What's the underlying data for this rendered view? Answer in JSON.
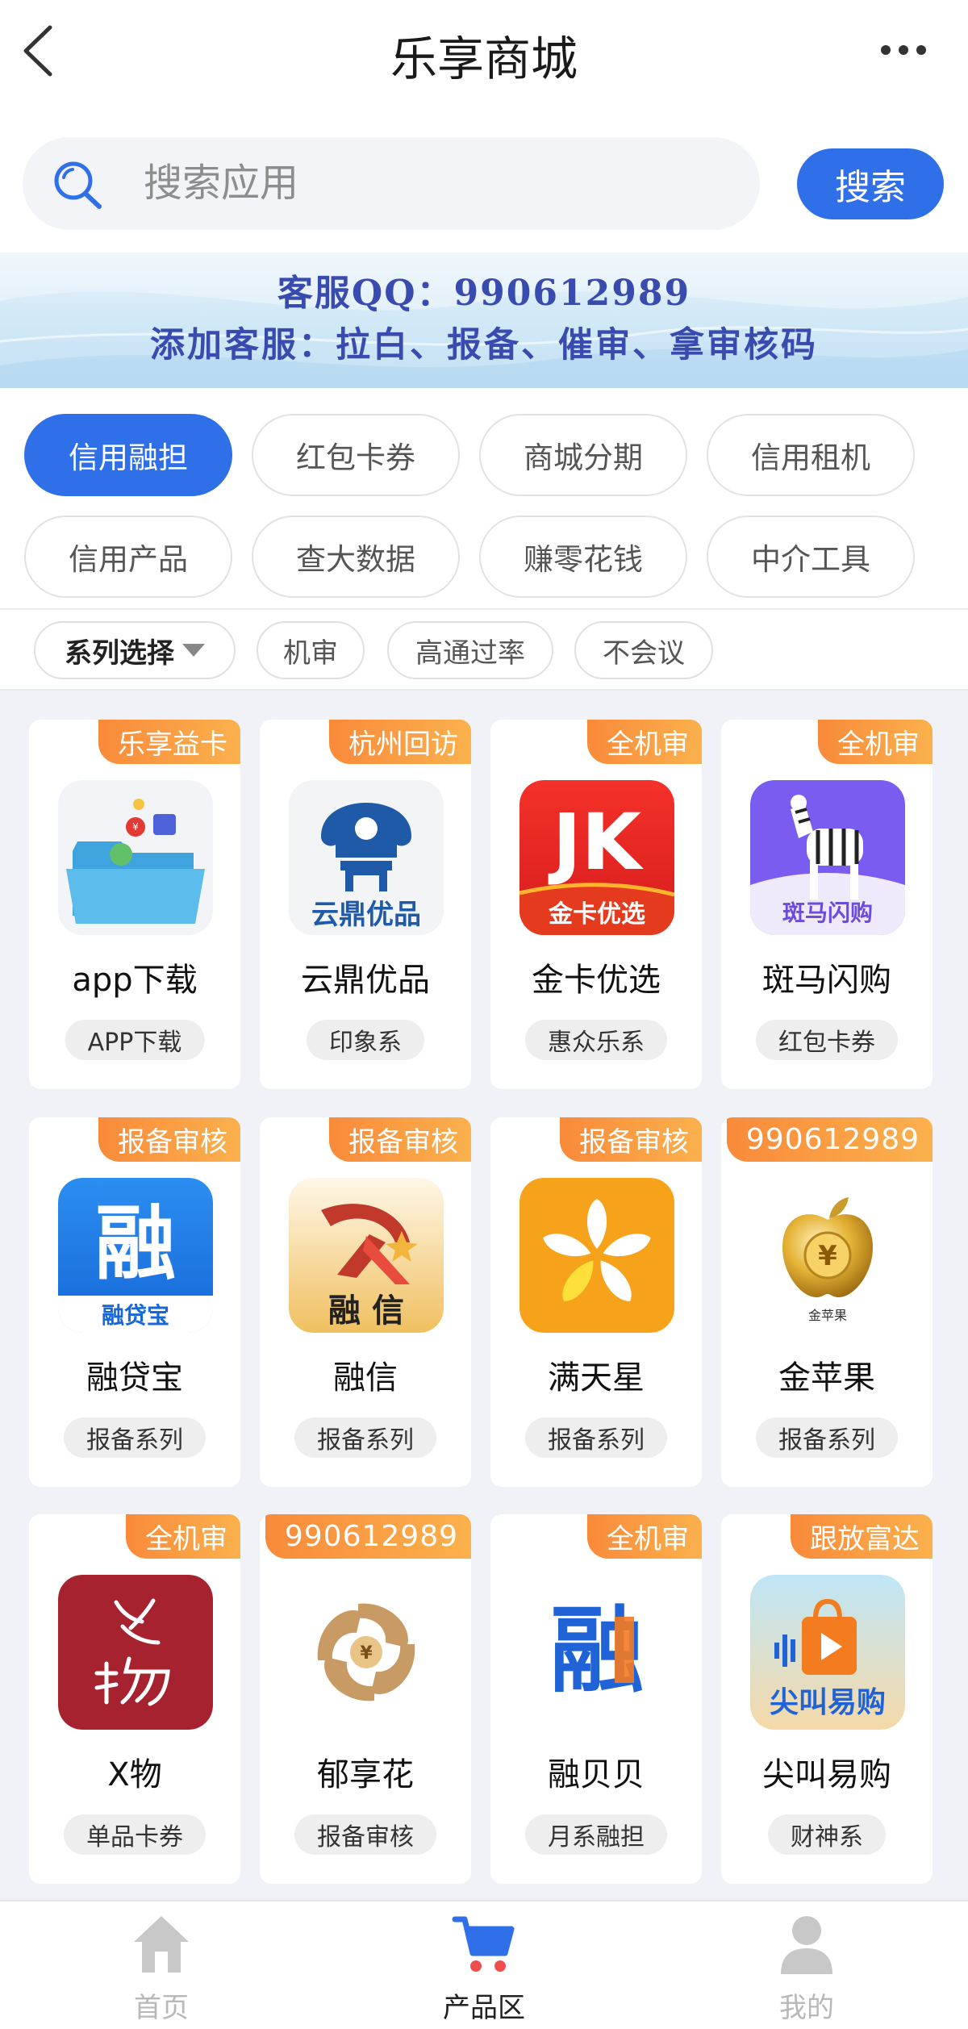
{
  "header": {
    "title": "乐享商城"
  },
  "search": {
    "placeholder": "搜索应用",
    "button_label": "搜索"
  },
  "banner": {
    "line1": "客服QQ：990612989",
    "line2": "添加客服：拉白、报备、催审、拿审核码"
  },
  "categories": [
    {
      "label": "信用融担",
      "active": true
    },
    {
      "label": "红包卡券",
      "active": false
    },
    {
      "label": "商城分期",
      "active": false
    },
    {
      "label": "信用租机",
      "active": false
    },
    {
      "label": "信用产品",
      "active": false
    },
    {
      "label": "查大数据",
      "active": false
    },
    {
      "label": "赚零花钱",
      "active": false
    },
    {
      "label": "中介工具",
      "active": false
    }
  ],
  "filters": {
    "select_label": "系列选择",
    "chips": [
      "机审",
      "高通过率",
      "不会议"
    ]
  },
  "products": [
    {
      "tag": "乐享益卡",
      "name": "app下载",
      "series": "APP下载",
      "icon": "folder-coins-icon"
    },
    {
      "tag": "杭州回访",
      "name": "云鼎优品",
      "series": "印象系",
      "icon": "yunding-logo-icon",
      "icon_text": "云鼎优品"
    },
    {
      "tag": "全机审",
      "name": "金卡优选",
      "series": "惠众乐系",
      "icon": "jk-logo-icon",
      "icon_text": "JK",
      "icon_subtext": "金卡优选"
    },
    {
      "tag": "全机审",
      "name": "斑马闪购",
      "series": "红包卡券",
      "icon": "zebra-logo-icon",
      "icon_text": "斑马闪购"
    },
    {
      "tag": "报备审核",
      "name": "融贷宝",
      "series": "报备系列",
      "icon": "rongdaibao-logo-icon",
      "icon_text": "融",
      "icon_subtext": "融贷宝"
    },
    {
      "tag": "报备审核",
      "name": "融信",
      "series": "报备系列",
      "icon": "rongxin-logo-icon",
      "icon_text": "融 信"
    },
    {
      "tag": "报备审核",
      "name": "满天星",
      "series": "报备系列",
      "icon": "orange-flower-icon"
    },
    {
      "tag": "990612989",
      "name": "金苹果",
      "series": "报备系列",
      "icon": "gold-apple-icon",
      "icon_text": "金苹果"
    },
    {
      "tag": "全机审",
      "name": "X物",
      "series": "单品卡券",
      "icon": "xwu-logo-icon"
    },
    {
      "tag": "990612989",
      "name": "郁享花",
      "series": "报备审核",
      "icon": "swirl-coin-icon"
    },
    {
      "tag": "全机审",
      "name": "融贝贝",
      "series": "月系融担",
      "icon": "rongbeibei-logo-icon",
      "icon_text": "融"
    },
    {
      "tag": "跟放富达",
      "name": "尖叫易购",
      "series": "财神系",
      "icon": "shopping-bag-icon",
      "icon_text": "尖叫易购"
    }
  ],
  "bottom_nav": [
    {
      "label": "首页",
      "icon": "home-icon",
      "active": false
    },
    {
      "label": "产品区",
      "icon": "cart-icon",
      "active": true
    },
    {
      "label": "我的",
      "icon": "user-icon",
      "active": false
    }
  ],
  "colors": {
    "accent": "#2f6fe8",
    "tag_gradient_start": "#f98a3a",
    "tag_gradient_end": "#fbb14d",
    "page_bg": "#f1f2f7"
  }
}
